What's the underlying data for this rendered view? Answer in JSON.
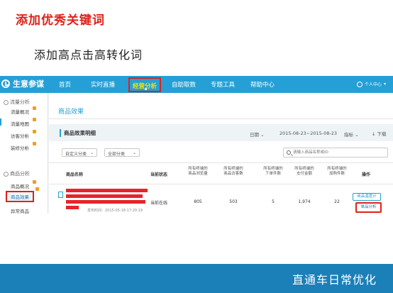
{
  "slide": {
    "title": "添加优秀关键词",
    "subtitle": "添加高点击高转化词",
    "footer": "直通车日常优化"
  },
  "nav": {
    "brand": "生意参谋",
    "items": [
      "首页",
      "实时直播",
      "经营分析",
      "自助取数",
      "专题工具",
      "帮助中心"
    ],
    "active_item": "经营分析",
    "user": "个人中心"
  },
  "sidebar": {
    "groups": [
      {
        "label": "流量分析",
        "items": [
          "流量概况",
          "流量地图",
          "访客分析",
          "装修分析"
        ]
      },
      {
        "label": "商品分析",
        "items": [
          "商品概况",
          "商品效果",
          "异常商品"
        ]
      }
    ],
    "active_item": "商品效果"
  },
  "content": {
    "heading": "商品效果",
    "section_title": "商品效果明细",
    "date_label": "日期",
    "date_range": "2015-08-23~2015-08-23",
    "metric_label": "指标",
    "download_label": "下载",
    "filter_custom": "自定义分类",
    "filter_all": "全部分类",
    "search_placeholder": "请输入商品名称或ID"
  },
  "table": {
    "columns": {
      "name": "商品名称",
      "status": "当前状态",
      "metrics": [
        [
          "所有终端的",
          "商品浏览量"
        ],
        [
          "所有终端的",
          "商品访客数"
        ],
        [
          "所有终端的",
          "下单件数"
        ],
        [
          "所有终端的",
          "支付金额"
        ],
        [
          "所有终端的",
          "加购件数"
        ]
      ],
      "action": "操作"
    },
    "rows": [
      {
        "publish_time": "发布时间：2015-05-18 17:20:19",
        "status": "当前在线",
        "values": [
          "805",
          "503",
          "5",
          "1,974",
          "22"
        ],
        "action_monitor": "商品温度计",
        "action_analysis": "单品分析"
      }
    ]
  },
  "colors": {
    "brand_blue": "#24a0d6",
    "highlight_red": "#e0211b",
    "footer_blue": "#1b7fb8"
  }
}
